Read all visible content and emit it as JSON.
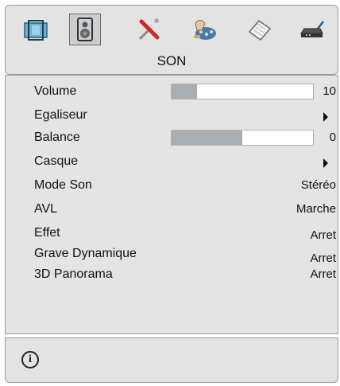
{
  "header": {
    "section_title": "SON",
    "tabs": [
      {
        "icon": "picture-icon",
        "label": ""
      },
      {
        "icon": "speaker-icon",
        "label": "",
        "selected": true
      },
      {
        "icon": "tools-icon",
        "label": ""
      },
      {
        "icon": "settings-icon",
        "label": ""
      },
      {
        "icon": "notebook-icon",
        "label": ""
      },
      {
        "icon": "source-icon",
        "label": ""
      }
    ]
  },
  "menu": {
    "items": [
      {
        "label": "Volume",
        "value": "10",
        "level": 0.18
      },
      {
        "label": "Egaliseur",
        "value": ""
      },
      {
        "label": "Balance",
        "value": "0",
        "level": 0.5
      },
      {
        "label": "Casque",
        "value": ""
      },
      {
        "label": "Mode Son",
        "value": "Stéréo"
      },
      {
        "label": "AVL",
        "value": "Marche"
      },
      {
        "label": "Effet",
        "value": "Arret"
      },
      {
        "label": "Grave Dynamique",
        "value": "Arret"
      },
      {
        "label": "3D Panorama",
        "value": "Arret"
      }
    ]
  },
  "info": {
    "icon": "info-icon",
    "glyph": "i"
  },
  "colors": {
    "panel": "#e3e3e3",
    "bar_fill": "#a9aeb2",
    "bar_bg": "#ffffff"
  }
}
